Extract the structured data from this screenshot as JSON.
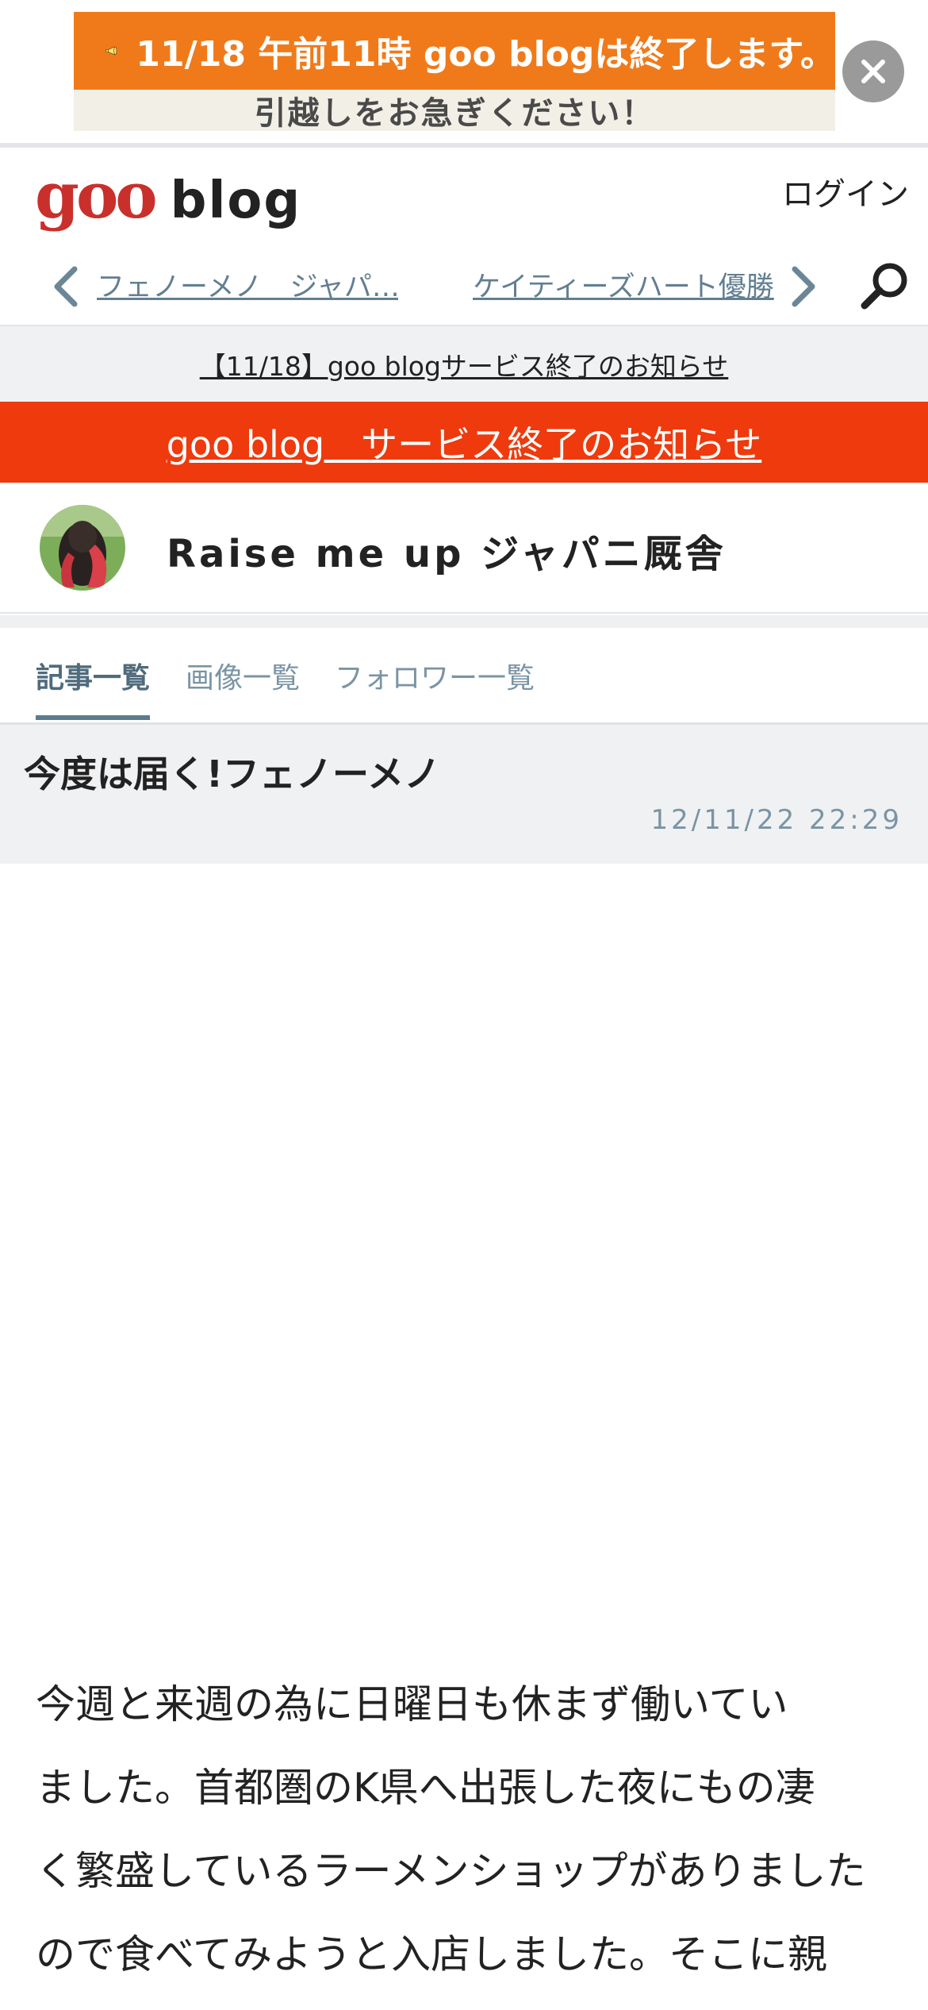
{
  "ad": {
    "line1": "11/18 午前11時 goo blogは終了します。",
    "line2": "引越しをお急ぎください！",
    "close_label": "×",
    "bg_color": "#f07a1a"
  },
  "header": {
    "logo_goo": "goo",
    "logo_blog": "blog",
    "login": "ログイン"
  },
  "article_nav": {
    "prev_title": "フェノーメノ　ジャパ…",
    "next_title": "ケイティーズハート優勝"
  },
  "notices": {
    "notice1": "【11/18】goo blogサービス終了のお知らせ",
    "notice2": "goo blog　サービス終了のお知らせ",
    "accent_color": "#ee3a0d"
  },
  "blog": {
    "name": "Raise me up ジャパニ厩舎"
  },
  "tabs": [
    {
      "label": "記事一覧",
      "active": true
    },
    {
      "label": "画像一覧",
      "active": false
    },
    {
      "label": "フォロワー一覧",
      "active": false
    }
  ],
  "article": {
    "title": "今度は届く!フェノーメノ",
    "date": "12/11/22 22:29",
    "body_lines": [
      "今週と来週の為に日曜日も休まず働いてい",
      "ました。首都圏のK県へ出張した夜にもの凄",
      "く繁盛しているラーメンショップがありました",
      "ので食べてみようと入店しました。そこに親"
    ]
  }
}
